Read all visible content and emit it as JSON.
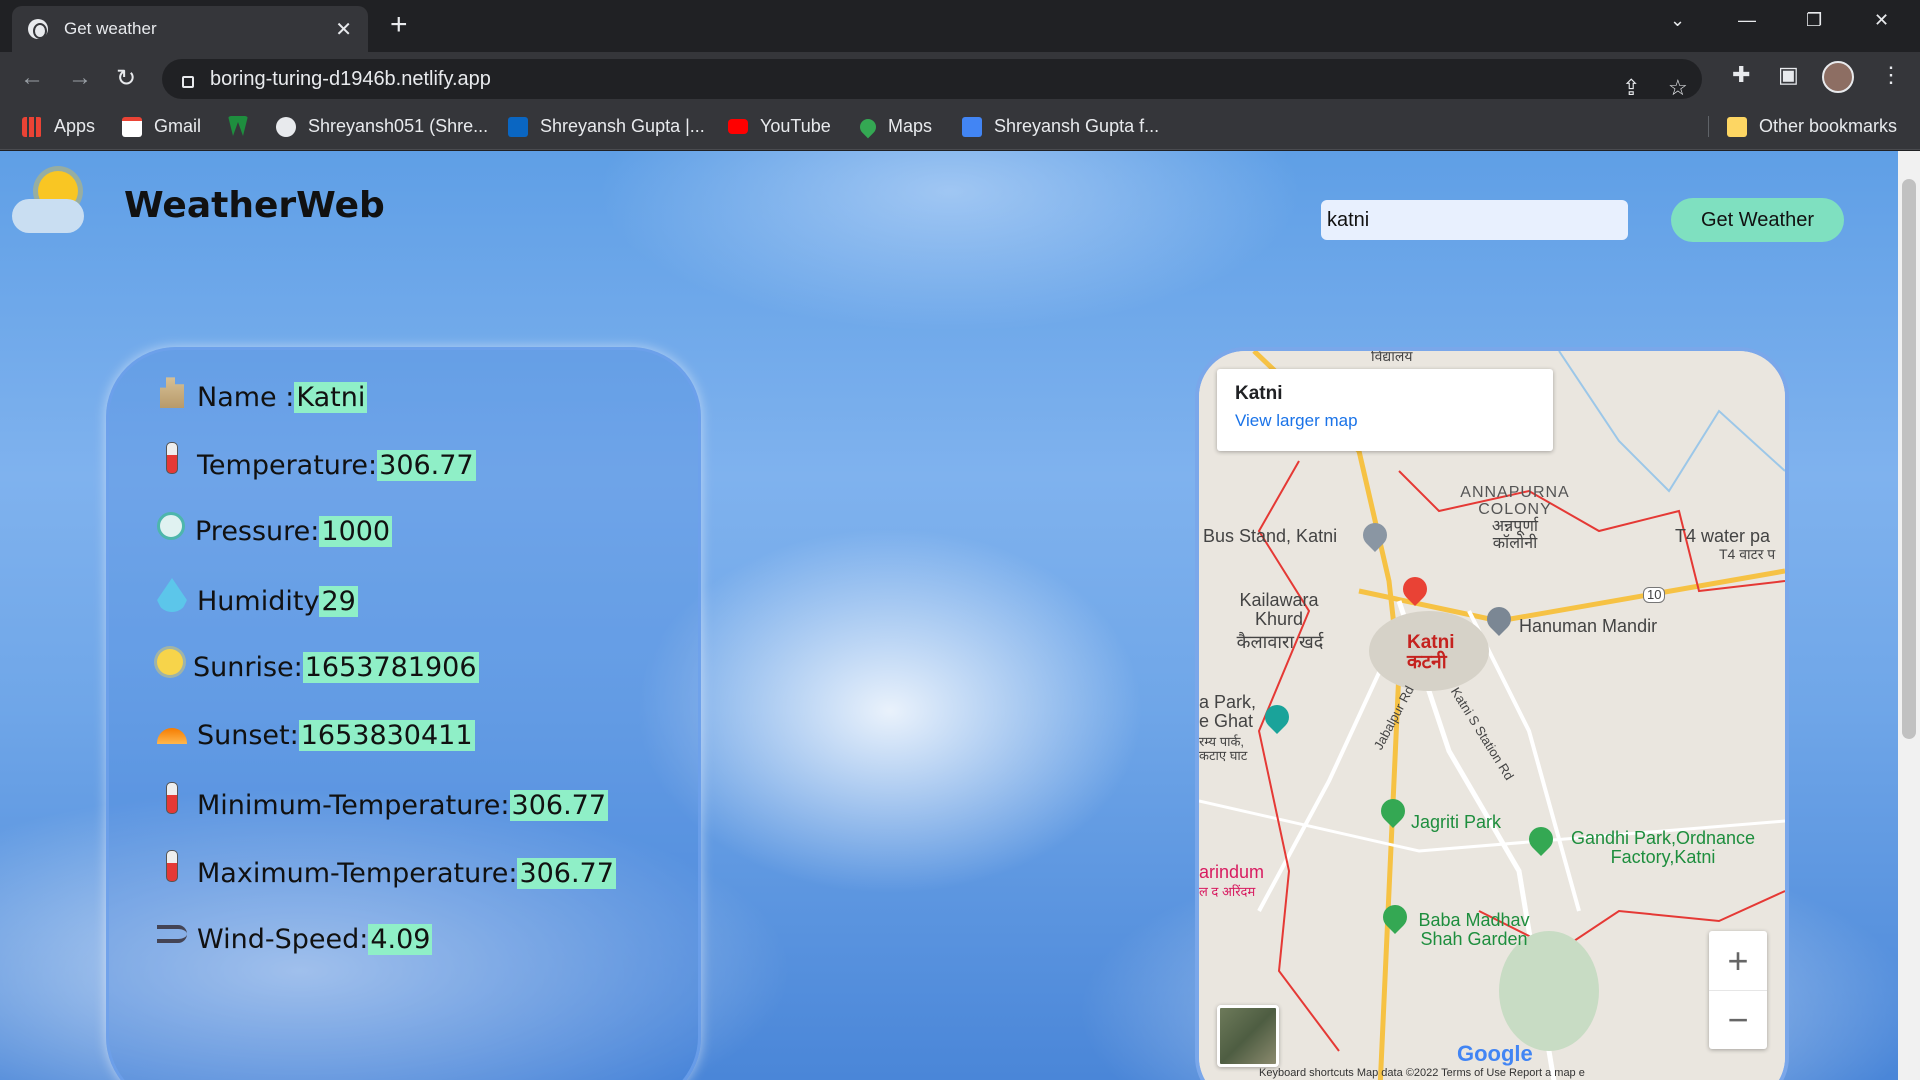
{
  "browser": {
    "tab_title": "Get weather",
    "url": "boring-turing-d1946b.netlify.app",
    "bookmarks": [
      "Apps",
      "Gmail",
      "",
      "Shreyansh051 (Shre...",
      "Shreyansh Gupta |...",
      "YouTube",
      "Maps",
      "Shreyansh Gupta f...",
      "Other bookmarks"
    ]
  },
  "app": {
    "brand": "WeatherWeb",
    "search_value": "katni",
    "button_label": "Get Weather"
  },
  "weather": {
    "name_label": "Name :",
    "name": "Katni",
    "temp_label": "Temperature:",
    "temp": "306.77",
    "pressure_label": "Pressure:",
    "pressure": "1000",
    "humidity_label": "Humidity",
    "humidity": "29",
    "sunrise_label": "Sunrise:",
    "sunrise": "1653781906",
    "sunset_label": "Sunset:",
    "sunset": "1653830411",
    "min_label": "Minimum-Temperature:",
    "min": "306.77",
    "max_label": "Maximum-Temperature:",
    "max": "306.77",
    "wind_label": "Wind-Speed:",
    "wind": "4.09"
  },
  "map": {
    "place": "Katni",
    "larger_link": "View larger map",
    "labels": {
      "vidyalay": "विद्यालय",
      "annapurna": "ANNAPURNA COLONY",
      "annapurna_hi": "अन्नपूर्णा कॉलोनी",
      "bus": "Bus Stand, Katni",
      "t4": "T4 water pa",
      "t4_hi": "T4 वाटर प",
      "kailawara": "Kailawara Khurd",
      "kailawara_hi": "कैलावारा खर्द",
      "katni": "Katni",
      "katni_hi": "कटनी",
      "hanuman": "Hanuman Mandir",
      "park": "a Park, e Ghat",
      "park_hi": "रम्य पार्क, कटाए घाट",
      "jabalpur": "Jabalpur Rd",
      "station": "Katni S Station Rd",
      "jagriti": "Jagriti Park",
      "gandhi": "Gandhi Park,Ordnance Factory,Katni",
      "arindum": "arindum",
      "arindum_hi": "ल द अरिंदम",
      "baba": "Baba Madhav Shah Garden",
      "highway": "10"
    },
    "google": "Google",
    "footer": "Keyboard shortcuts    Map data ©2022    Terms of Use    Report a map e"
  },
  "colors": {
    "value_highlight": "#8fefc7",
    "button": "#7fe0c0"
  }
}
